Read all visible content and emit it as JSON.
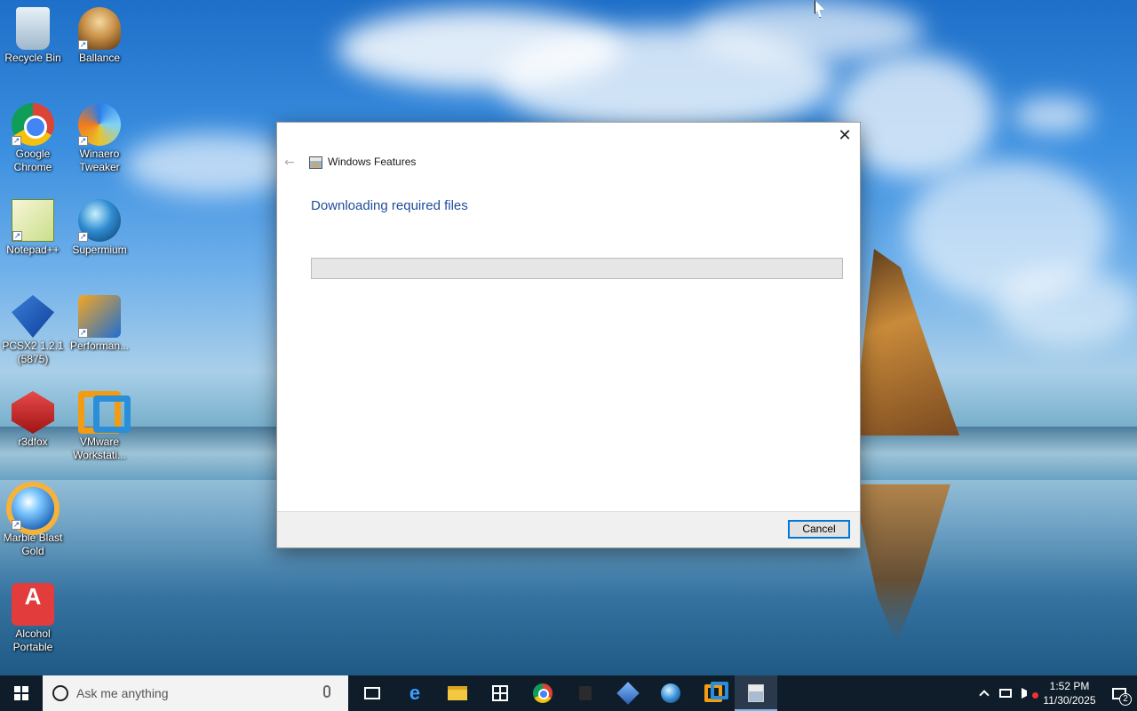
{
  "desktop": {
    "icons": [
      {
        "label": "Recycle Bin"
      },
      {
        "label": "Ballance"
      },
      {
        "label": "Google Chrome"
      },
      {
        "label": "Winaero Tweaker"
      },
      {
        "label": "Notepad++"
      },
      {
        "label": "Supermium"
      },
      {
        "label": "PCSX2 1.2.1 (5875)"
      },
      {
        "label": "Performan..."
      },
      {
        "label": "r3dfox"
      },
      {
        "label": "VMware Workstati..."
      },
      {
        "label": "Marble Blast Gold"
      },
      {
        "label": "Alcohol Portable"
      }
    ]
  },
  "dialog": {
    "app_title": "Windows Features",
    "heading": "Downloading required files",
    "progress": 0,
    "cancel_label": "Cancel",
    "close_glyph": "✕",
    "back_glyph": "←"
  },
  "taskbar": {
    "search_placeholder": "Ask me anything",
    "apps": [
      "task-view",
      "edge",
      "file-explorer",
      "store",
      "chrome",
      "lock",
      "diamond-app",
      "supermium",
      "vmware",
      "windows-features"
    ],
    "active_app": "windows-features",
    "clock_time": "1:52 PM",
    "clock_date": "11/30/2025",
    "notification_count": "2"
  }
}
